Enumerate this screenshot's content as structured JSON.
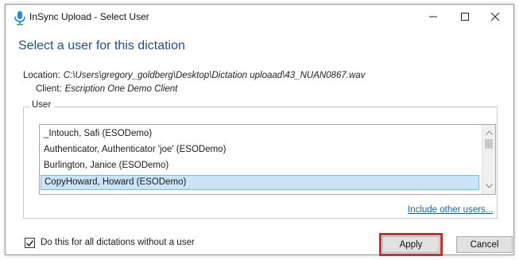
{
  "window": {
    "title": "InSync Upload - Select User",
    "minimize_icon": "minimize-icon",
    "maximize_icon": "maximize-icon",
    "close_icon": "close-icon"
  },
  "heading": "Select a user for this dictation",
  "location": {
    "label": "Location:",
    "value": "C:\\Users\\gregory_goldberg\\Desktop\\Dictation uploaad\\43_NUAN0867.wav"
  },
  "client": {
    "label": "Client:",
    "value": "Escription One Demo Client"
  },
  "user_group": {
    "label": "User",
    "items": [
      {
        "label": "_Intouch, Safi (ESODemo)",
        "selected": false
      },
      {
        "label": "Authenticator, Authenticator 'joe' (ESODemo)",
        "selected": false
      },
      {
        "label": "Burlington, Janice (ESODemo)",
        "selected": false
      },
      {
        "label": "CopyHoward, Howard (ESODemo)",
        "selected": true
      }
    ],
    "include_link": "Include other users..."
  },
  "footer": {
    "checkbox_label": "Do this for all dictations without a user",
    "checkbox_checked": true,
    "apply_label": "Apply",
    "cancel_label": "Cancel"
  },
  "colors": {
    "heading": "#1f4e8c",
    "selection": "#cce4f7",
    "highlight": "#d42a2a",
    "link": "#1a5fb4"
  }
}
